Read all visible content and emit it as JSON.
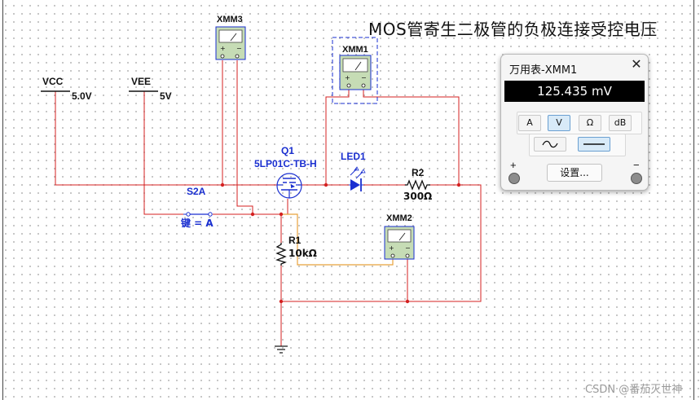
{
  "title": "MOS管寄生二极管的负极连接受控电压",
  "watermark": "CSDN @番茄灭世神",
  "components": {
    "vcc": {
      "name": "VCC",
      "value": "5.0V"
    },
    "vee": {
      "name": "VEE",
      "value": "5V"
    },
    "switch": {
      "name": "S2A",
      "key": "键 = A"
    },
    "q1": {
      "name": "Q1",
      "model": "5LP01C-TB-H"
    },
    "led": {
      "name": "LED1"
    },
    "r2": {
      "name": "R2",
      "value": "300Ω"
    },
    "r1": {
      "name": "R1",
      "value": "10kΩ"
    },
    "xmm1": {
      "name": "XMM1",
      "plus": "+",
      "minus": "−"
    },
    "xmm2": {
      "name": "XMM2",
      "plus": "+",
      "minus": "−"
    },
    "xmm3": {
      "name": "XMM3",
      "plus": "+",
      "minus": "−"
    }
  },
  "multimeter": {
    "title": "万用表-XMM1",
    "close": "✕",
    "reading": "125.435 mV",
    "modes": [
      "A",
      "V",
      "Ω",
      "dB"
    ],
    "active_mode": "V",
    "waveform_active": "dc",
    "plus": "+",
    "minus": "−",
    "settings": "设置..."
  },
  "colors": {
    "wire_red": "#d42020",
    "wire_orange": "#e8a23c",
    "component_blue": "#1a2fd0",
    "component_black": "#111111"
  }
}
